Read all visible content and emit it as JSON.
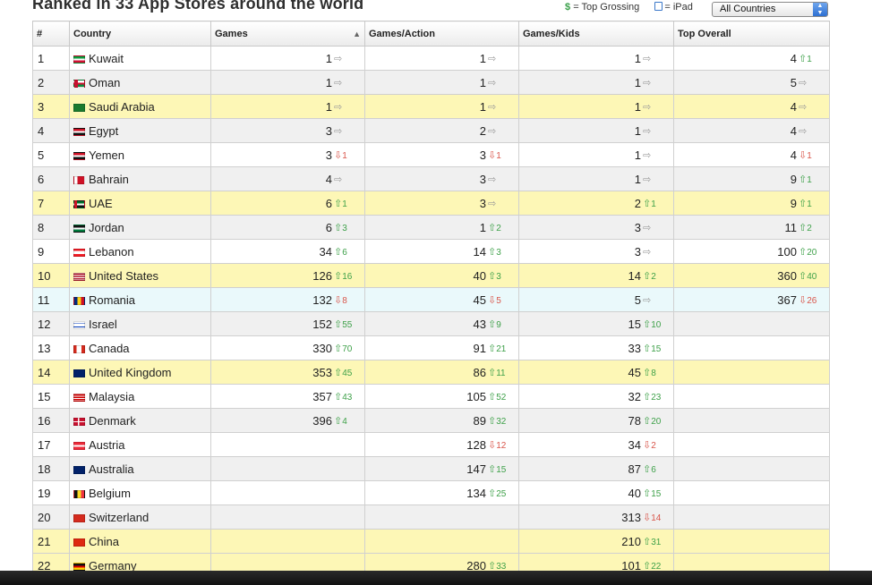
{
  "page": {
    "title": "Ranked in 33 App Stores around the world",
    "legend": {
      "top_grossing_symbol": "$",
      "top_grossing_label": "= Top Grossing",
      "ipad_label": "= iPad"
    },
    "country_select": {
      "selected": "All Countries"
    }
  },
  "table": {
    "headers": [
      "#",
      "Country",
      "Games",
      "Games/Action",
      "Games/Kids",
      "Top Overall"
    ],
    "sort_indicator": "▲",
    "rows": [
      {
        "n": "1",
        "country": "Kuwait",
        "flag": "kw",
        "style": "plain",
        "games": {
          "v": "1",
          "d": "same",
          "c": ""
        },
        "action": {
          "v": "1",
          "d": "same",
          "c": ""
        },
        "kids": {
          "v": "1",
          "d": "same",
          "c": ""
        },
        "overall": {
          "v": "4",
          "d": "up",
          "c": "1"
        }
      },
      {
        "n": "2",
        "country": "Oman",
        "flag": "om",
        "style": "alt",
        "games": {
          "v": "1",
          "d": "same",
          "c": ""
        },
        "action": {
          "v": "1",
          "d": "same",
          "c": ""
        },
        "kids": {
          "v": "1",
          "d": "same",
          "c": ""
        },
        "overall": {
          "v": "5",
          "d": "same",
          "c": ""
        }
      },
      {
        "n": "3",
        "country": "Saudi Arabia",
        "flag": "sa",
        "style": "hl",
        "games": {
          "v": "1",
          "d": "same",
          "c": ""
        },
        "action": {
          "v": "1",
          "d": "same",
          "c": ""
        },
        "kids": {
          "v": "1",
          "d": "same",
          "c": ""
        },
        "overall": {
          "v": "4",
          "d": "same",
          "c": ""
        }
      },
      {
        "n": "4",
        "country": "Egypt",
        "flag": "eg",
        "style": "alt",
        "games": {
          "v": "3",
          "d": "same",
          "c": ""
        },
        "action": {
          "v": "2",
          "d": "same",
          "c": ""
        },
        "kids": {
          "v": "1",
          "d": "same",
          "c": ""
        },
        "overall": {
          "v": "4",
          "d": "same",
          "c": ""
        }
      },
      {
        "n": "5",
        "country": "Yemen",
        "flag": "ye",
        "style": "plain",
        "games": {
          "v": "3",
          "d": "down",
          "c": "1"
        },
        "action": {
          "v": "3",
          "d": "down",
          "c": "1"
        },
        "kids": {
          "v": "1",
          "d": "same",
          "c": ""
        },
        "overall": {
          "v": "4",
          "d": "down",
          "c": "1"
        }
      },
      {
        "n": "6",
        "country": "Bahrain",
        "flag": "bh",
        "style": "alt",
        "games": {
          "v": "4",
          "d": "same",
          "c": ""
        },
        "action": {
          "v": "3",
          "d": "same",
          "c": ""
        },
        "kids": {
          "v": "1",
          "d": "same",
          "c": ""
        },
        "overall": {
          "v": "9",
          "d": "up",
          "c": "1"
        }
      },
      {
        "n": "7",
        "country": "UAE",
        "flag": "ae",
        "style": "hl",
        "games": {
          "v": "6",
          "d": "up",
          "c": "1"
        },
        "action": {
          "v": "3",
          "d": "same",
          "c": ""
        },
        "kids": {
          "v": "2",
          "d": "up",
          "c": "1"
        },
        "overall": {
          "v": "9",
          "d": "up",
          "c": "1"
        }
      },
      {
        "n": "8",
        "country": "Jordan",
        "flag": "jo",
        "style": "alt",
        "games": {
          "v": "6",
          "d": "up",
          "c": "3"
        },
        "action": {
          "v": "1",
          "d": "up",
          "c": "2"
        },
        "kids": {
          "v": "3",
          "d": "same",
          "c": ""
        },
        "overall": {
          "v": "11",
          "d": "up",
          "c": "2"
        }
      },
      {
        "n": "9",
        "country": "Lebanon",
        "flag": "lb",
        "style": "plain",
        "games": {
          "v": "34",
          "d": "up",
          "c": "6"
        },
        "action": {
          "v": "14",
          "d": "up",
          "c": "3"
        },
        "kids": {
          "v": "3",
          "d": "same",
          "c": ""
        },
        "overall": {
          "v": "100",
          "d": "up",
          "c": "20"
        }
      },
      {
        "n": "10",
        "country": "United States",
        "flag": "us",
        "style": "hl",
        "games": {
          "v": "126",
          "d": "up",
          "c": "16"
        },
        "action": {
          "v": "40",
          "d": "up",
          "c": "3"
        },
        "kids": {
          "v": "14",
          "d": "up",
          "c": "2"
        },
        "overall": {
          "v": "360",
          "d": "up",
          "c": "40"
        }
      },
      {
        "n": "11",
        "country": "Romania",
        "flag": "ro",
        "style": "sel",
        "games": {
          "v": "132",
          "d": "down",
          "c": "8"
        },
        "action": {
          "v": "45",
          "d": "down",
          "c": "5"
        },
        "kids": {
          "v": "5",
          "d": "same",
          "c": ""
        },
        "overall": {
          "v": "367",
          "d": "down",
          "c": "26"
        }
      },
      {
        "n": "12",
        "country": "Israel",
        "flag": "il",
        "style": "alt",
        "games": {
          "v": "152",
          "d": "up",
          "c": "55"
        },
        "action": {
          "v": "43",
          "d": "up",
          "c": "9"
        },
        "kids": {
          "v": "15",
          "d": "up",
          "c": "10"
        },
        "overall": {
          "v": "",
          "d": "",
          "c": ""
        }
      },
      {
        "n": "13",
        "country": "Canada",
        "flag": "ca",
        "style": "plain",
        "games": {
          "v": "330",
          "d": "up",
          "c": "70"
        },
        "action": {
          "v": "91",
          "d": "up",
          "c": "21"
        },
        "kids": {
          "v": "33",
          "d": "up",
          "c": "15"
        },
        "overall": {
          "v": "",
          "d": "",
          "c": ""
        }
      },
      {
        "n": "14",
        "country": "United Kingdom",
        "flag": "gb",
        "style": "hl",
        "games": {
          "v": "353",
          "d": "up",
          "c": "45"
        },
        "action": {
          "v": "86",
          "d": "up",
          "c": "11"
        },
        "kids": {
          "v": "45",
          "d": "up",
          "c": "8"
        },
        "overall": {
          "v": "",
          "d": "",
          "c": ""
        }
      },
      {
        "n": "15",
        "country": "Malaysia",
        "flag": "my",
        "style": "plain",
        "games": {
          "v": "357",
          "d": "up",
          "c": "43"
        },
        "action": {
          "v": "105",
          "d": "up",
          "c": "52"
        },
        "kids": {
          "v": "32",
          "d": "up",
          "c": "23"
        },
        "overall": {
          "v": "",
          "d": "",
          "c": ""
        }
      },
      {
        "n": "16",
        "country": "Denmark",
        "flag": "dk",
        "style": "alt",
        "games": {
          "v": "396",
          "d": "up",
          "c": "4"
        },
        "action": {
          "v": "89",
          "d": "up",
          "c": "32"
        },
        "kids": {
          "v": "78",
          "d": "up",
          "c": "20"
        },
        "overall": {
          "v": "",
          "d": "",
          "c": ""
        }
      },
      {
        "n": "17",
        "country": "Austria",
        "flag": "at",
        "style": "plain",
        "games": {
          "v": "",
          "d": "",
          "c": ""
        },
        "action": {
          "v": "128",
          "d": "down",
          "c": "12"
        },
        "kids": {
          "v": "34",
          "d": "down",
          "c": "2"
        },
        "overall": {
          "v": "",
          "d": "",
          "c": ""
        }
      },
      {
        "n": "18",
        "country": "Australia",
        "flag": "au",
        "style": "alt",
        "games": {
          "v": "",
          "d": "",
          "c": ""
        },
        "action": {
          "v": "147",
          "d": "up",
          "c": "15"
        },
        "kids": {
          "v": "87",
          "d": "up",
          "c": "6"
        },
        "overall": {
          "v": "",
          "d": "",
          "c": ""
        }
      },
      {
        "n": "19",
        "country": "Belgium",
        "flag": "be",
        "style": "plain",
        "games": {
          "v": "",
          "d": "",
          "c": ""
        },
        "action": {
          "v": "134",
          "d": "up",
          "c": "25"
        },
        "kids": {
          "v": "40",
          "d": "up",
          "c": "15"
        },
        "overall": {
          "v": "",
          "d": "",
          "c": ""
        }
      },
      {
        "n": "20",
        "country": "Switzerland",
        "flag": "ch",
        "style": "alt",
        "games": {
          "v": "",
          "d": "",
          "c": ""
        },
        "action": {
          "v": "",
          "d": "",
          "c": ""
        },
        "kids": {
          "v": "313",
          "d": "down",
          "c": "14"
        },
        "overall": {
          "v": "",
          "d": "",
          "c": ""
        }
      },
      {
        "n": "21",
        "country": "China",
        "flag": "cn",
        "style": "hl",
        "games": {
          "v": "",
          "d": "",
          "c": ""
        },
        "action": {
          "v": "",
          "d": "",
          "c": ""
        },
        "kids": {
          "v": "210",
          "d": "up",
          "c": "31"
        },
        "overall": {
          "v": "",
          "d": "",
          "c": ""
        }
      },
      {
        "n": "22",
        "country": "Germany",
        "flag": "de",
        "style": "hl",
        "games": {
          "v": "",
          "d": "",
          "c": ""
        },
        "action": {
          "v": "280",
          "d": "up",
          "c": "33"
        },
        "kids": {
          "v": "101",
          "d": "up",
          "c": "22"
        },
        "overall": {
          "v": "",
          "d": "",
          "c": ""
        }
      }
    ]
  },
  "colors": {
    "highlight_row": "#fdf7b6",
    "alt_row": "#f0f0f0",
    "selected_row": "#eaf9fb",
    "up": "#3fa14a",
    "down": "#d9574c",
    "same": "#9a9a9a"
  }
}
